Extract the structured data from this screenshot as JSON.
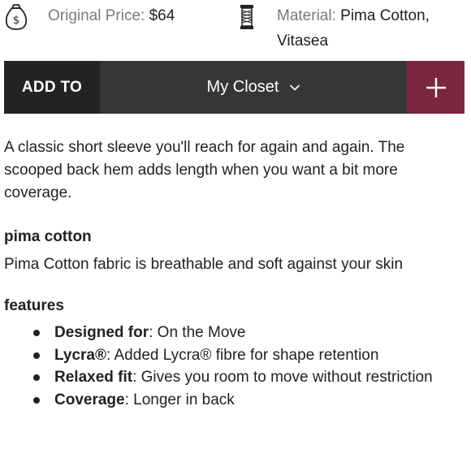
{
  "details": {
    "price_label": "Original Price:",
    "price_value": "$64",
    "material_label": "Material:",
    "material_value_line1": "Pima Cotton,",
    "material_value_line2": "Vitasea"
  },
  "add_bar": {
    "add_to_label": "ADD TO",
    "closet_value": "My Closet",
    "plus_icon": "plus-icon",
    "colors": {
      "add_to_bg": "#232323",
      "select_bg": "#363636",
      "plus_bg": "#7b2740"
    }
  },
  "description": "A classic short sleeve you'll reach for again and again. The scooped back hem adds length when you want a bit more coverage.",
  "fabric": {
    "title": "pima cotton",
    "body": "Pima Cotton fabric is breathable and soft against your skin"
  },
  "features": {
    "title": "features",
    "items": [
      {
        "key": "Designed for",
        "value": ": On the Move"
      },
      {
        "key": "Lycra®",
        "value": ": Added Lycra® fibre for shape retention"
      },
      {
        "key": "Relaxed fit",
        "value": ": Gives you room to move without restriction"
      },
      {
        "key": "Coverage",
        "value": ": Longer in back"
      }
    ]
  }
}
